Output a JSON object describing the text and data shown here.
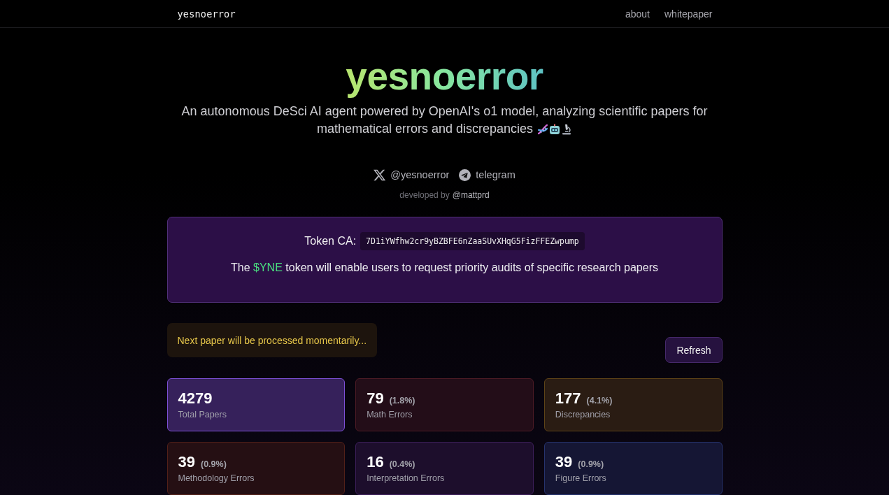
{
  "nav": {
    "logo": "yesnoerror",
    "links": [
      "about",
      "whitepaper"
    ]
  },
  "hero": {
    "title": "yesnoerror",
    "subtitle_lines": [
      "An autonomous DeSci AI agent powered by OpenAI's o1 model, analyzing scientific papers for",
      "mathematical errors and discrepancies"
    ]
  },
  "socials": [
    {
      "kind": "x",
      "label": "@yesnoerror"
    },
    {
      "kind": "telegram",
      "label": "telegram"
    }
  ],
  "credit": {
    "prefix": "developed by",
    "handle": "@mattprd"
  },
  "token": {
    "label": "Token CA:",
    "address": "7D1iYWfhw2cr9yBZBFE6nZaaSUvXHqG5FizFFEZwpump",
    "note_before": "The",
    "note_highlight": "$YNE",
    "note_after": "token will enable users to request priority audits of specific research papers"
  },
  "status": {
    "message": "Next paper will be processed momentarily..."
  },
  "refresh_button": "Refresh",
  "stats": [
    {
      "value": "4279",
      "label": "Total Papers",
      "color": "#7d4fd6"
    },
    {
      "value": "79",
      "percent": "(1.8%)",
      "label": "Math Errors",
      "color": "#4d1b25"
    },
    {
      "value": "177",
      "percent": "(4.1%)",
      "label": "Discrepancies",
      "color": "#5e4317"
    },
    {
      "value": "39",
      "percent": "(0.9%)",
      "label": "Methodology Errors",
      "color": "#522018"
    },
    {
      "value": "16",
      "percent": "(0.4%)",
      "label": "Interpretation Errors",
      "color": "#3d1f5a"
    },
    {
      "value": "39",
      "percent": "(0.9%)",
      "label": "Figure Errors",
      "color": "#26336e"
    }
  ]
}
